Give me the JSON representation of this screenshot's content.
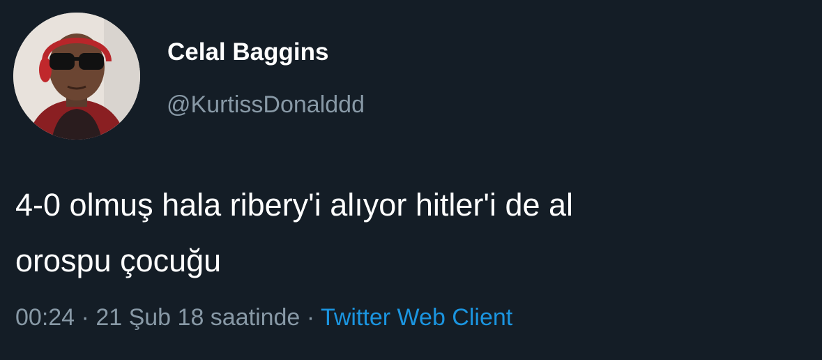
{
  "user": {
    "display_name": "Celal Baggins",
    "handle": "@KurtissDonalddd"
  },
  "tweet": {
    "text_line1": "4-0 olmuş hala ribery'i alıyor hitler'i de al",
    "text_line2": "orospu çocuğu"
  },
  "meta": {
    "time": "00:24",
    "separator": "·",
    "date": "21 Şub 18 saatinde",
    "source": "Twitter Web Client"
  },
  "colors": {
    "background": "#141d26",
    "name": "#ffffff",
    "secondary": "#8899a6",
    "link": "#1b95e0"
  }
}
